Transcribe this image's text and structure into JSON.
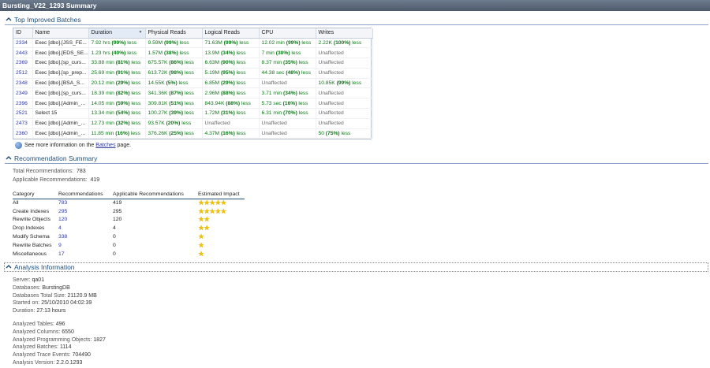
{
  "window": {
    "title": "Bursting_V22_1293 Summary"
  },
  "top_batches": {
    "heading": "Top Improved Batches",
    "columns": [
      "ID",
      "Name",
      "Duration",
      "Physical Reads",
      "Logical Reads",
      "CPU",
      "Writes"
    ],
    "sorted_column": "Duration",
    "rows": [
      {
        "id": "2334",
        "name": "Exec [dbo].[JSS_FE...",
        "duration_v": "7.92 hrs",
        "duration_p": "(99%)",
        "phys_v": "9.59M",
        "phys_p": "(99%)",
        "log_v": "71.63M",
        "log_p": "(99%)",
        "cpu_v": "12.02 min",
        "cpu_p": "(99%)",
        "wr_v": "2.22K",
        "wr_p": "(100%)",
        "cpu_unaff": "",
        "wr_unaff": "",
        "phys_unaff": "",
        "log_unaff": ""
      },
      {
        "id": "2443",
        "name": "Exec [dbo].[EDS_SE...",
        "duration_v": "1.23 hrs",
        "duration_p": "(40%)",
        "phys_v": "1.57M",
        "phys_p": "(38%)",
        "log_v": "13.9M",
        "log_p": "(34%)",
        "cpu_v": "7 min",
        "cpu_p": "(30%)",
        "wr_v": "",
        "wr_p": "",
        "cpu_unaff": "",
        "wr_unaff": "Unaffected",
        "phys_unaff": "",
        "log_unaff": ""
      },
      {
        "id": "2369",
        "name": "Exec [dbo].[sp_curs...",
        "duration_v": "33.88 min",
        "duration_p": "(81%)",
        "phys_v": "675.57K",
        "phys_p": "(86%)",
        "log_v": "6.63M",
        "log_p": "(90%)",
        "cpu_v": "8.37 min",
        "cpu_p": "(35%)",
        "wr_v": "",
        "wr_p": "",
        "cpu_unaff": "",
        "wr_unaff": "Unaffected",
        "phys_unaff": "",
        "log_unaff": ""
      },
      {
        "id": "2512",
        "name": "Exec [dbo].[sp_prep...",
        "duration_v": "25.69 min",
        "duration_p": "(91%)",
        "phys_v": "613.72K",
        "phys_p": "(98%)",
        "log_v": "5.19M",
        "log_p": "(95%)",
        "cpu_v": "44.38 sec",
        "cpu_p": "(48%)",
        "wr_v": "",
        "wr_p": "",
        "cpu_unaff": "",
        "wr_unaff": "Unaffected",
        "phys_unaff": "",
        "log_unaff": ""
      },
      {
        "id": "2348",
        "name": "Exec [dbo].[BSA_S...",
        "duration_v": "20.12 min",
        "duration_p": "(29%)",
        "phys_v": "14.55K",
        "phys_p": "(5%)",
        "log_v": "6.85M",
        "log_p": "(29%)",
        "cpu_v": "",
        "cpu_p": "",
        "wr_v": "10.85K",
        "wr_p": "(99%)",
        "cpu_unaff": "Unaffected",
        "wr_unaff": "",
        "phys_unaff": "",
        "log_unaff": ""
      },
      {
        "id": "2349",
        "name": "Exec [dbo].[sp_curs...",
        "duration_v": "18.39 min",
        "duration_p": "(82%)",
        "phys_v": "341.36K",
        "phys_p": "(87%)",
        "log_v": "2.96M",
        "log_p": "(88%)",
        "cpu_v": "3.71 min",
        "cpu_p": "(34%)",
        "wr_v": "",
        "wr_p": "",
        "cpu_unaff": "",
        "wr_unaff": "Unaffected",
        "phys_unaff": "",
        "log_unaff": ""
      },
      {
        "id": "2396",
        "name": "Exec [dbo].[Admin_...",
        "duration_v": "14.05 min",
        "duration_p": "(59%)",
        "phys_v": "309.81K",
        "phys_p": "(51%)",
        "log_v": "843.94K",
        "log_p": "(88%)",
        "cpu_v": "5.73 sec",
        "cpu_p": "(16%)",
        "wr_v": "",
        "wr_p": "",
        "cpu_unaff": "",
        "wr_unaff": "Unaffected",
        "phys_unaff": "",
        "log_unaff": ""
      },
      {
        "id": "2521",
        "name": "Select 15",
        "duration_v": "13.34 min",
        "duration_p": "(54%)",
        "phys_v": "100.27K",
        "phys_p": "(39%)",
        "log_v": "1.72M",
        "log_p": "(31%)",
        "cpu_v": "6.31 min",
        "cpu_p": "(70%)",
        "wr_v": "",
        "wr_p": "",
        "cpu_unaff": "",
        "wr_unaff": "Unaffected",
        "phys_unaff": "",
        "log_unaff": ""
      },
      {
        "id": "2473",
        "name": "Exec [dbo].[Admin_...",
        "duration_v": "12.73 min",
        "duration_p": "(32%)",
        "phys_v": "93.57K",
        "phys_p": "(20%)",
        "log_v": "",
        "log_p": "",
        "cpu_v": "",
        "cpu_p": "",
        "wr_v": "",
        "wr_p": "",
        "cpu_unaff": "Unaffected",
        "wr_unaff": "Unaffected",
        "phys_unaff": "",
        "log_unaff": "Unaffected"
      },
      {
        "id": "2360",
        "name": "Exec [dbo].[Admin_...",
        "duration_v": "11.85 min",
        "duration_p": "(16%)",
        "phys_v": "376.26K",
        "phys_p": "(25%)",
        "log_v": "4.37M",
        "log_p": "(16%)",
        "cpu_v": "",
        "cpu_p": "",
        "wr_v": "50",
        "wr_p": "(75%)",
        "cpu_unaff": "Unaffected",
        "wr_unaff": "",
        "phys_unaff": "",
        "log_unaff": ""
      }
    ],
    "less_word": "less",
    "more_info_prefix": "See more information on the",
    "more_info_link": "Batches",
    "more_info_suffix": "page."
  },
  "recommendation_summary": {
    "heading": "Recommendation Summary",
    "total_label": "Total Recommendations:",
    "total_value": "783",
    "applicable_label": "Applicable Recommendations:",
    "applicable_value": "419",
    "columns": [
      "Category",
      "Recommendations",
      "Applicable Recommendations",
      "Estimated Impact"
    ],
    "rows": [
      {
        "category": "All",
        "recs": "783",
        "applicable": "419",
        "stars": 5
      },
      {
        "category": "Create Indexes",
        "recs": "295",
        "applicable": "295",
        "stars": 5
      },
      {
        "category": "Rewrite Objects",
        "recs": "120",
        "applicable": "120",
        "stars": 2
      },
      {
        "category": "Drop Indexes",
        "recs": "4",
        "applicable": "4",
        "stars": 2
      },
      {
        "category": "Modify Schema",
        "recs": "338",
        "applicable": "0",
        "stars": 1
      },
      {
        "category": "Rewrite Batches",
        "recs": "9",
        "applicable": "0",
        "stars": 1
      },
      {
        "category": "Miscellaneous",
        "recs": "17",
        "applicable": "0",
        "stars": 1
      }
    ]
  },
  "analysis": {
    "heading": "Analysis Information",
    "group1": [
      {
        "label": "Server:",
        "value": "qa01"
      },
      {
        "label": "Databases:",
        "value": "BurstingDB"
      },
      {
        "label": "Databases Total Size:",
        "value": "21120.9 MB"
      },
      {
        "label": "Started on:",
        "value": "25/10/2010 04:02:39"
      },
      {
        "label": "Duration:",
        "value": "27:13 hours"
      }
    ],
    "group2": [
      {
        "label": "Analyzed Tables:",
        "value": "496"
      },
      {
        "label": "Analyzed Columns:",
        "value": "6550"
      },
      {
        "label": "Analyzed Programming Objects:",
        "value": "1827"
      },
      {
        "label": "Analyzed Batches:",
        "value": "1114"
      },
      {
        "label": "Analyzed Trace Events:",
        "value": "704490"
      },
      {
        "label": "Analysis Version:",
        "value": "2.2.0.1293"
      }
    ]
  },
  "colors": {
    "improved": "#0b7a16",
    "link": "#2e3a9e",
    "header": "#1f4e79",
    "star": "#f2c200"
  }
}
